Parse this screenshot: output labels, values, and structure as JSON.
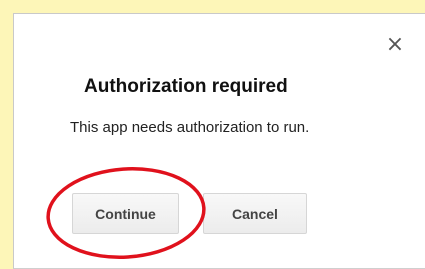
{
  "dialog": {
    "title": "Authorization required",
    "message": "This app needs authorization to run.",
    "close_glyph": "×",
    "close_icon": "close-icon",
    "buttons": {
      "continue_label": "Continue",
      "cancel_label": "Cancel"
    }
  },
  "annotation": {
    "highlight_color": "#e0111c",
    "page_background": "#fdf6b8"
  }
}
